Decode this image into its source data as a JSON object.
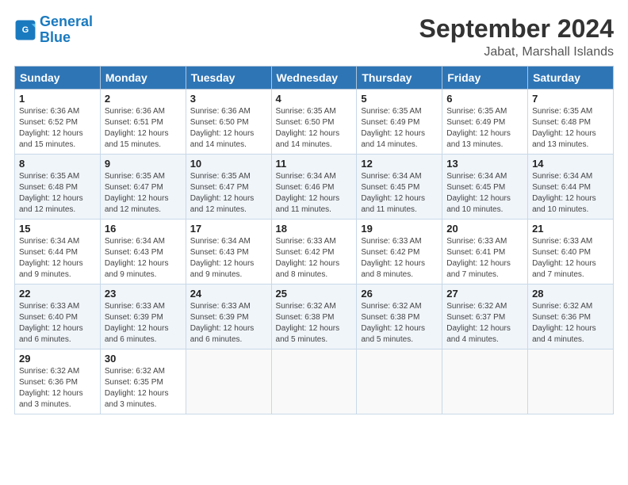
{
  "logo": {
    "line1": "General",
    "line2": "Blue"
  },
  "title": "September 2024",
  "subtitle": "Jabat, Marshall Islands",
  "headers": [
    "Sunday",
    "Monday",
    "Tuesday",
    "Wednesday",
    "Thursday",
    "Friday",
    "Saturday"
  ],
  "weeks": [
    [
      {
        "day": "1",
        "info": "Sunrise: 6:36 AM\nSunset: 6:52 PM\nDaylight: 12 hours\nand 15 minutes."
      },
      {
        "day": "2",
        "info": "Sunrise: 6:36 AM\nSunset: 6:51 PM\nDaylight: 12 hours\nand 15 minutes."
      },
      {
        "day": "3",
        "info": "Sunrise: 6:36 AM\nSunset: 6:50 PM\nDaylight: 12 hours\nand 14 minutes."
      },
      {
        "day": "4",
        "info": "Sunrise: 6:35 AM\nSunset: 6:50 PM\nDaylight: 12 hours\nand 14 minutes."
      },
      {
        "day": "5",
        "info": "Sunrise: 6:35 AM\nSunset: 6:49 PM\nDaylight: 12 hours\nand 14 minutes."
      },
      {
        "day": "6",
        "info": "Sunrise: 6:35 AM\nSunset: 6:49 PM\nDaylight: 12 hours\nand 13 minutes."
      },
      {
        "day": "7",
        "info": "Sunrise: 6:35 AM\nSunset: 6:48 PM\nDaylight: 12 hours\nand 13 minutes."
      }
    ],
    [
      {
        "day": "8",
        "info": "Sunrise: 6:35 AM\nSunset: 6:48 PM\nDaylight: 12 hours\nand 12 minutes."
      },
      {
        "day": "9",
        "info": "Sunrise: 6:35 AM\nSunset: 6:47 PM\nDaylight: 12 hours\nand 12 minutes."
      },
      {
        "day": "10",
        "info": "Sunrise: 6:35 AM\nSunset: 6:47 PM\nDaylight: 12 hours\nand 12 minutes."
      },
      {
        "day": "11",
        "info": "Sunrise: 6:34 AM\nSunset: 6:46 PM\nDaylight: 12 hours\nand 11 minutes."
      },
      {
        "day": "12",
        "info": "Sunrise: 6:34 AM\nSunset: 6:45 PM\nDaylight: 12 hours\nand 11 minutes."
      },
      {
        "day": "13",
        "info": "Sunrise: 6:34 AM\nSunset: 6:45 PM\nDaylight: 12 hours\nand 10 minutes."
      },
      {
        "day": "14",
        "info": "Sunrise: 6:34 AM\nSunset: 6:44 PM\nDaylight: 12 hours\nand 10 minutes."
      }
    ],
    [
      {
        "day": "15",
        "info": "Sunrise: 6:34 AM\nSunset: 6:44 PM\nDaylight: 12 hours\nand 9 minutes."
      },
      {
        "day": "16",
        "info": "Sunrise: 6:34 AM\nSunset: 6:43 PM\nDaylight: 12 hours\nand 9 minutes."
      },
      {
        "day": "17",
        "info": "Sunrise: 6:34 AM\nSunset: 6:43 PM\nDaylight: 12 hours\nand 9 minutes."
      },
      {
        "day": "18",
        "info": "Sunrise: 6:33 AM\nSunset: 6:42 PM\nDaylight: 12 hours\nand 8 minutes."
      },
      {
        "day": "19",
        "info": "Sunrise: 6:33 AM\nSunset: 6:42 PM\nDaylight: 12 hours\nand 8 minutes."
      },
      {
        "day": "20",
        "info": "Sunrise: 6:33 AM\nSunset: 6:41 PM\nDaylight: 12 hours\nand 7 minutes."
      },
      {
        "day": "21",
        "info": "Sunrise: 6:33 AM\nSunset: 6:40 PM\nDaylight: 12 hours\nand 7 minutes."
      }
    ],
    [
      {
        "day": "22",
        "info": "Sunrise: 6:33 AM\nSunset: 6:40 PM\nDaylight: 12 hours\nand 6 minutes."
      },
      {
        "day": "23",
        "info": "Sunrise: 6:33 AM\nSunset: 6:39 PM\nDaylight: 12 hours\nand 6 minutes."
      },
      {
        "day": "24",
        "info": "Sunrise: 6:33 AM\nSunset: 6:39 PM\nDaylight: 12 hours\nand 6 minutes."
      },
      {
        "day": "25",
        "info": "Sunrise: 6:32 AM\nSunset: 6:38 PM\nDaylight: 12 hours\nand 5 minutes."
      },
      {
        "day": "26",
        "info": "Sunrise: 6:32 AM\nSunset: 6:38 PM\nDaylight: 12 hours\nand 5 minutes."
      },
      {
        "day": "27",
        "info": "Sunrise: 6:32 AM\nSunset: 6:37 PM\nDaylight: 12 hours\nand 4 minutes."
      },
      {
        "day": "28",
        "info": "Sunrise: 6:32 AM\nSunset: 6:36 PM\nDaylight: 12 hours\nand 4 minutes."
      }
    ],
    [
      {
        "day": "29",
        "info": "Sunrise: 6:32 AM\nSunset: 6:36 PM\nDaylight: 12 hours\nand 3 minutes."
      },
      {
        "day": "30",
        "info": "Sunrise: 6:32 AM\nSunset: 6:35 PM\nDaylight: 12 hours\nand 3 minutes."
      },
      {
        "day": "",
        "info": ""
      },
      {
        "day": "",
        "info": ""
      },
      {
        "day": "",
        "info": ""
      },
      {
        "day": "",
        "info": ""
      },
      {
        "day": "",
        "info": ""
      }
    ]
  ]
}
